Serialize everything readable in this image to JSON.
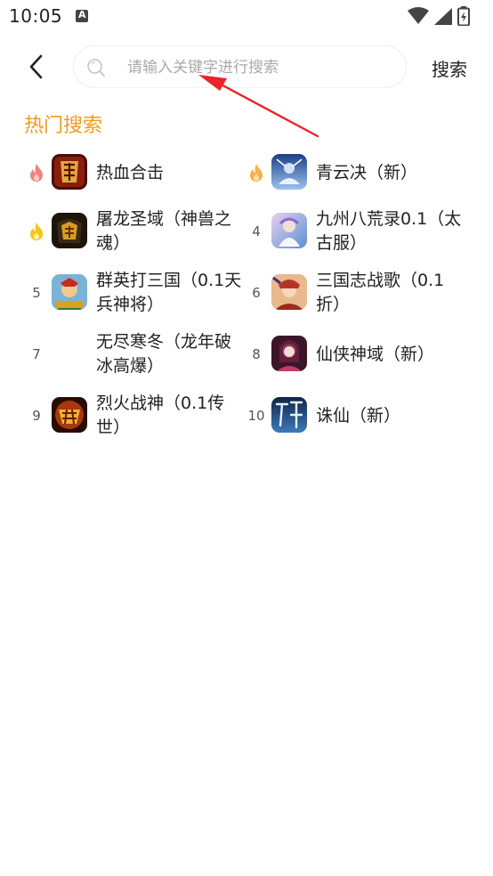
{
  "status_bar": {
    "time": "10:05"
  },
  "header": {
    "back_icon": "chevron-left-icon",
    "search_placeholder": "请输入关键字进行搜索",
    "search_value": "",
    "search_button_label": "搜索"
  },
  "hot_search": {
    "title": "热门搜索",
    "items": [
      {
        "rank": "1",
        "rank_icon": "fire-red-icon",
        "name": "热血合击",
        "icon_color": "#7a1a0e"
      },
      {
        "rank": "2",
        "rank_icon": "fire-orange-icon",
        "name": "青云决（新）",
        "icon_color": "#2c4a8a"
      },
      {
        "rank": "3",
        "rank_icon": "fire-yellow-icon",
        "name": "屠龙圣域（神兽之魂）",
        "icon_color": "#3b2a12"
      },
      {
        "rank": "4",
        "rank_icon": "",
        "name": "九州八荒录0.1（太古服）",
        "icon_color": "#6fa8d8"
      },
      {
        "rank": "5",
        "rank_icon": "",
        "name": "群英打三国（0.1天兵神将）",
        "icon_color": "#c9a23a"
      },
      {
        "rank": "6",
        "rank_icon": "",
        "name": "三国志战歌（0.1折）",
        "icon_color": "#b84a3c"
      },
      {
        "rank": "7",
        "rank_icon": "",
        "name": "无尽寒冬（龙年破冰高爆）",
        "icon_color": ""
      },
      {
        "rank": "8",
        "rank_icon": "",
        "name": "仙侠神域（新）",
        "icon_color": "#7a2c4c"
      },
      {
        "rank": "9",
        "rank_icon": "",
        "name": "烈火战神（0.1传世）",
        "icon_color": "#b8431a"
      },
      {
        "rank": "10",
        "rank_icon": "",
        "name": "诛仙（新）",
        "icon_color": "#1c3e6e"
      }
    ]
  },
  "colors": {
    "accent": "#f39a1e",
    "annotation": "#e8262a"
  }
}
